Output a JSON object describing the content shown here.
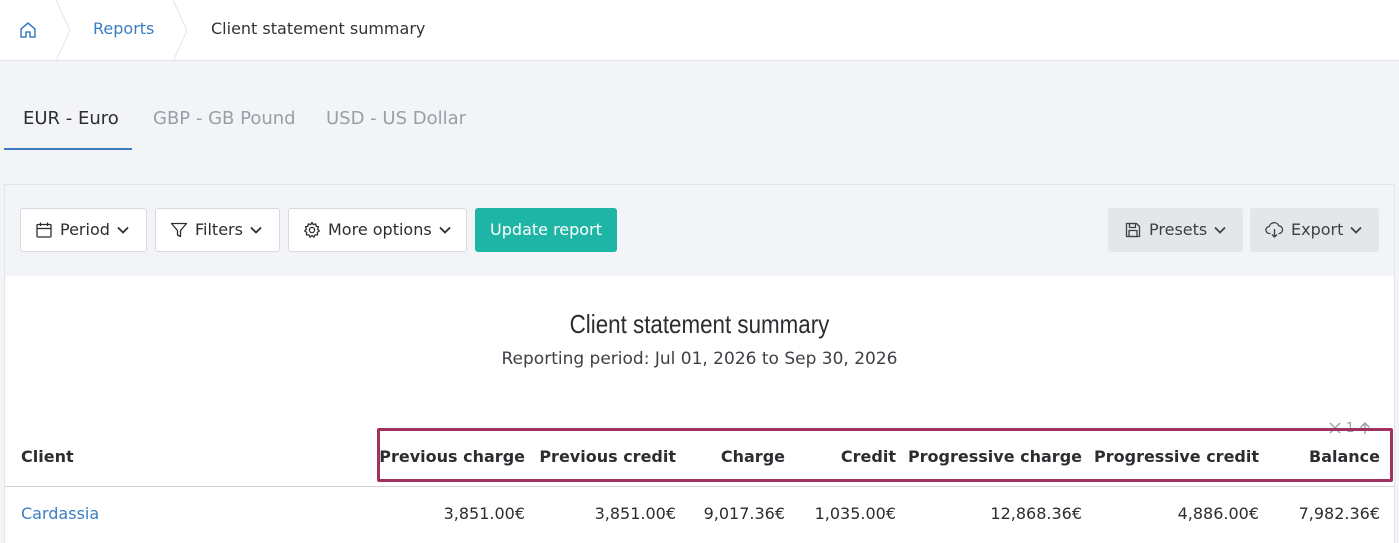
{
  "breadcrumb": {
    "home_icon": "home-icon",
    "items": [
      {
        "label": "Reports"
      },
      {
        "label": "Client statement summary"
      }
    ]
  },
  "currency_tabs": [
    {
      "label": "EUR - Euro",
      "active": true
    },
    {
      "label": "GBP - GB Pound",
      "active": false
    },
    {
      "label": "USD - US Dollar",
      "active": false
    }
  ],
  "toolbar": {
    "period_label": "Period",
    "filters_label": "Filters",
    "more_options_label": "More options",
    "update_label": "Update report",
    "presets_label": "Presets",
    "export_label": "Export"
  },
  "report": {
    "title": "Client statement summary",
    "subtitle": "Reporting period: Jul 01, 2026 to Sep 30, 2026"
  },
  "pagination": {
    "page": "1"
  },
  "table": {
    "columns": [
      "Client",
      "Previous charge",
      "Previous credit",
      "Charge",
      "Credit",
      "Progressive charge",
      "Progressive credit",
      "Balance"
    ],
    "rows": [
      [
        "Cardassia",
        "3,851.00€",
        "3,851.00€",
        "9,017.36€",
        "1,035.00€",
        "12,868.36€",
        "4,886.00€",
        "7,982.36€"
      ]
    ]
  },
  "colors": {
    "accent": "#3a7ec1",
    "primary_button": "#1fb5a6",
    "highlight_border": "#a03262"
  }
}
